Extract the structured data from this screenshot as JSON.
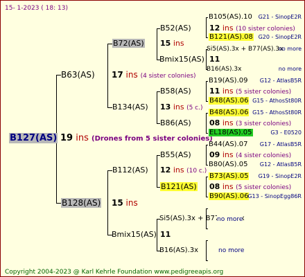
{
  "header": "15-  1-2023 ( 18: 13)",
  "footer": "Copyright 2004-2023 @ Karl Kehrle Foundation    www.pedigreeapis.org",
  "colors": {
    "gray": "#b8b8b8",
    "yellow": "#ffff33",
    "green": "#22cc22",
    "ins": "#b00000",
    "note": "#7a0080",
    "right": "#000080"
  },
  "root": {
    "name": "B127(AS)",
    "num": "19",
    "ins": "ins",
    "note": "(Drones from 5 sister colonies)"
  },
  "g1": {
    "top": {
      "name": "B63(AS)"
    },
    "bottom": {
      "name": "B128(AS)",
      "num": "15",
      "ins": "ins"
    }
  },
  "g2": {
    "b72": {
      "name": "B72(AS)",
      "num": "15",
      "ins": "ins"
    },
    "b63_row": {
      "num": "17",
      "ins": "ins",
      "note": "(4 sister colonies)"
    },
    "b134": {
      "name": "B134(AS)",
      "num": "13",
      "ins": "ins",
      "note": "(5 c.)"
    },
    "b112": {
      "name": "B112(AS)",
      "num": "12",
      "ins": "ins",
      "note": "(10 c.)"
    },
    "bmix15": {
      "name": "Bmix15(AS)",
      "num": "11"
    }
  },
  "g3": {
    "b52": {
      "name": "B52(AS)",
      "num": "12",
      "ins": "ins",
      "note": "(10 sister colonies)"
    },
    "bmix15a": {
      "name": "Bmix15(AS)",
      "num": "11"
    },
    "b58": {
      "name": "B58(AS)",
      "num": "11",
      "ins": "ins",
      "note": "(5 sister colonies)"
    },
    "b86": {
      "name": "B86(AS)",
      "num": "08",
      "ins": "ins",
      "note": "(3 sister colonies)"
    },
    "b55": {
      "name": "B55(AS)",
      "num": "09",
      "ins": "ins",
      "note": "(4 sister colonies)"
    },
    "b121": {
      "name": "B121(AS)",
      "num": "08",
      "ins": "ins",
      "note": "(5 sister colonies)"
    },
    "si5": {
      "name": "Si5(AS).3x + B77(AS).3x",
      "tail": "no more"
    },
    "b16": {
      "name": "B16(AS).3x",
      "tail": "no more"
    }
  },
  "g4": [
    {
      "name": "B105(AS).10",
      "right": "G21 - SinopE2R"
    },
    {
      "name": "B121(AS).08",
      "right": "G20 - SinopE2R"
    },
    {
      "name": "Si5(AS).3x + B77(AS).3x",
      "right": "no more"
    },
    {
      "name": "B16(AS).3x",
      "right": "no more"
    },
    {
      "name": "B19(AS).09",
      "right": "G12 - AtlasB5R"
    },
    {
      "name": "B48(AS).06",
      "right": "G15 - AthosSt80R"
    },
    {
      "name": "B48(AS).06",
      "right": "G15 - AthosSt80R"
    },
    {
      "name": "EL18(AS).05",
      "right": "G3 - E0520"
    },
    {
      "name": "B44(AS).07",
      "right": "G17 - AtlasB5R"
    },
    {
      "name": "B80(AS).05",
      "right": "G12 - AtlasB5R"
    },
    {
      "name": "B73(AS).05",
      "right": "G19 - SinopE2R"
    },
    {
      "name": "B90(AS).06",
      "right": "G13 - SinopEgg86R"
    }
  ]
}
